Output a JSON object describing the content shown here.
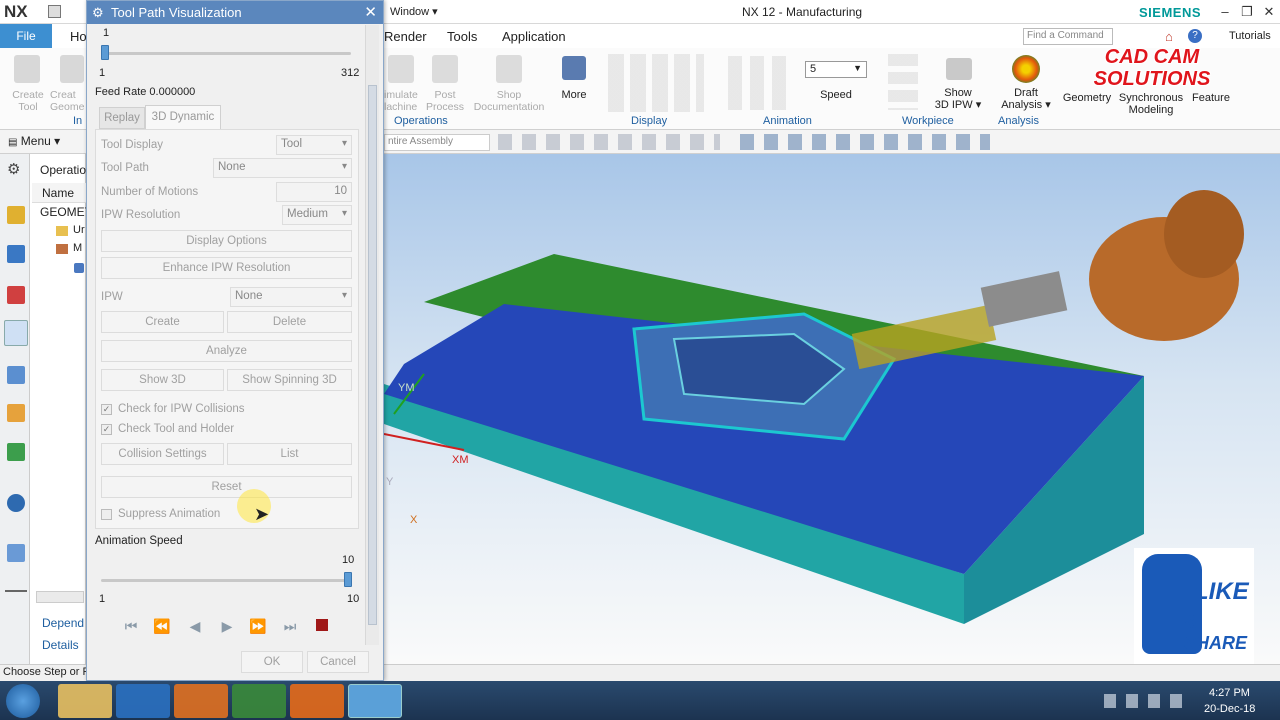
{
  "app": {
    "logo": "NX",
    "window_menu": "Window ▾",
    "title": "NX 12 - Manufacturing",
    "brand": "SIEMENS",
    "search_placeholder": "Find a Command",
    "tutorials": "Tutorials"
  },
  "tabs": {
    "file": "File",
    "home": "Ho",
    "render": "Render",
    "tools": "Tools",
    "application": "Application"
  },
  "ribbon": {
    "create_tool": "Create\nTool",
    "create_geom": "Creat\nGeome",
    "insert_group": "In",
    "simulate": "imulate\nlachine",
    "post": "Post\nProcess",
    "shop_doc": "Shop\nDocumentation",
    "more": "More",
    "operations_group": "Operations",
    "display_group": "Display",
    "animation_group": "Animation",
    "workpiece_group": "Workpiece",
    "analysis_group": "Analysis",
    "speed_value": "5",
    "speed_label": "Speed",
    "show_ipw": "Show\n3D IPW ▾",
    "draft_analysis": "Draft\nAnalysis ▾",
    "geometry": "Geometry",
    "sync_modeling": "Synchronous\nModeling",
    "feature": "Feature"
  },
  "watermark": {
    "line1": "CAD CAM",
    "line2": "SOLUTIONS"
  },
  "toolrow": {
    "menu": "Menu ▾",
    "assembly_filter": "ntire Assembly"
  },
  "navigator": {
    "header": "Operatio",
    "col_name": "Name",
    "row_geom": "GEOMET",
    "row_un": "Ur",
    "row_m": "M",
    "dependencies": "Depend",
    "details": "Details"
  },
  "status": {
    "text": "Choose Step or F"
  },
  "dialog": {
    "title": "Tool Path Visualization",
    "step_value": "1",
    "step_min": "1",
    "step_max": "312",
    "feed_rate": "Feed Rate 0.000000",
    "tab_replay": "Replay",
    "tab_3d": "3D Dynamic",
    "tool_display_label": "Tool Display",
    "tool_display_value": "Tool",
    "tool_path_label": "Tool Path",
    "tool_path_value": "None",
    "num_motions_label": "Number of Motions",
    "num_motions_value": "10",
    "ipw_res_label": "IPW Resolution",
    "ipw_res_value": "Medium",
    "display_options": "Display Options",
    "enhance_ipw": "Enhance IPW Resolution",
    "ipw_label": "IPW",
    "ipw_value": "None",
    "create": "Create",
    "delete": "Delete",
    "analyze": "Analyze",
    "show_3d": "Show 3D",
    "show_spinning": "Show Spinning 3D",
    "check_collisions": "Check for IPW Collisions",
    "check_holder": "Check Tool and Holder",
    "collision_settings": "Collision Settings",
    "list": "List",
    "reset": "Reset",
    "suppress_anim": "Suppress Animation",
    "anim_speed_label": "Animation Speed",
    "speed_value": "10",
    "speed_min": "1",
    "speed_max": "10",
    "ok": "OK",
    "cancel": "Cancel"
  },
  "viewport": {
    "axis_ym": "YM",
    "axis_xm": "XM",
    "axis_x": "X",
    "axis_y": "Y"
  },
  "like_share": {
    "line1": "LIKE",
    "line2": "& SHARE"
  },
  "taskbar": {
    "time": "4:27 PM",
    "date": "20-Dec-18"
  }
}
